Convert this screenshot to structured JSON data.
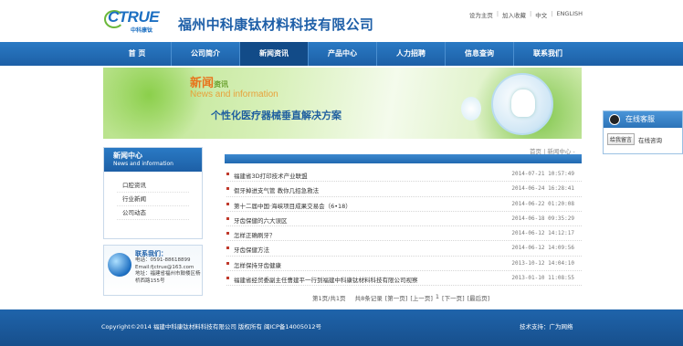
{
  "header": {
    "logo_text": "CTRUE",
    "logo_sub": "中科康钛",
    "company_name": "福州中科康钛材料科技有限公司",
    "top_links": [
      "设为主页",
      "加入收藏",
      "中文",
      "ENGLISH"
    ]
  },
  "nav": {
    "items": [
      "首 页",
      "公司简介",
      "新闻资讯",
      "产品中心",
      "人力招聘",
      "信息查询",
      "联系我们"
    ],
    "active_index": 2
  },
  "banner": {
    "title": "新闻",
    "title_small": "资讯",
    "subtitle_en": "News and information",
    "slogan": "个性化医疗器械垂直解决方案"
  },
  "qq": {
    "title": "在线客服",
    "message_button": "给我留言",
    "consult_label": "在线咨询"
  },
  "sidebar": {
    "title": "新闻中心",
    "title_en": "News and information",
    "items": [
      "口腔资讯",
      "行业新闻",
      "公司动态"
    ]
  },
  "contact": {
    "title": "联系我们：",
    "phone": "电话：0591-88618899",
    "email": "Email:fjctrue@163.com",
    "address": "地址：福建省福州市鼓楼区杨桥西路155号"
  },
  "breadcrumb": [
    "首页",
    "新闻中心"
  ],
  "news": [
    {
      "title": "福建省3D打印技术产业联盟",
      "date": "2014-07-21 10:57:49"
    },
    {
      "title": "假牙掉进支气管 教你几招急救法",
      "date": "2014-06-24 16:28:41"
    },
    {
      "title": "第十二届中国·海峡项目成果交易会（6•18）",
      "date": "2014-06-22 01:20:08"
    },
    {
      "title": "牙齿保健的六大误区",
      "date": "2014-06-18 09:35:29"
    },
    {
      "title": "怎样正确刷牙？",
      "date": "2014-06-12 14:12:17"
    },
    {
      "title": "牙齿保健方法",
      "date": "2014-06-12 14:09:56"
    },
    {
      "title": "怎样保持牙齿健康",
      "date": "2013-10-12 14:04:10"
    },
    {
      "title": "福建省经贸委副主任曹建平一行到福建中科康钛材料科技有限公司视察",
      "date": "2013-01-10 11:08:55"
    }
  ],
  "pager": {
    "page_info": "第1页/共1页",
    "records": "共8条记录",
    "first": "[第一页]",
    "prev": "[上一页]",
    "current": "1",
    "next": "[下一页]",
    "last": "[最后页]"
  },
  "footer": {
    "copyright": "Copyright©2014  福建中科康钛材料科技有限公司 版权所有 闽ICP备14005012号",
    "support": "技术支持：广为网络"
  },
  "colors": {
    "nav_blue": "#1d5fa6",
    "title_orange": "#e8731c",
    "slogan_blue": "#1f5f9f"
  }
}
